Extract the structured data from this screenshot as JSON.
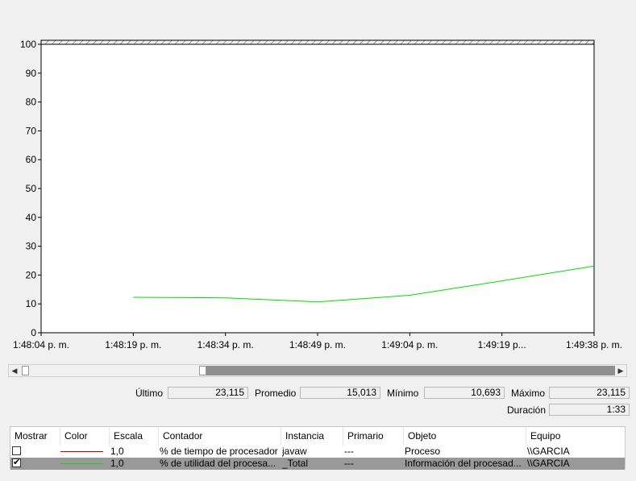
{
  "chart_data": {
    "type": "line",
    "x": [
      "1:48:04 p. m.",
      "1:48:19 p. m.",
      "1:48:34 p. m.",
      "1:48:49 p. m.",
      "1:49:04 p. m.",
      "1:49:19 p...",
      "1:49:38 p. m."
    ],
    "ylim": [
      0,
      100
    ],
    "yticks": [
      0,
      10,
      20,
      30,
      40,
      50,
      60,
      70,
      80,
      90,
      100
    ],
    "grid": false,
    "series": [
      {
        "color": "#00dd00",
        "points": [
          [
            1,
            12.3
          ],
          [
            2,
            12.1
          ],
          [
            3,
            10.7
          ],
          [
            4,
            13.0
          ],
          [
            5,
            18.0
          ],
          [
            6,
            23.1
          ]
        ]
      }
    ]
  },
  "stats": {
    "last_label": "Último",
    "last_value": "23,115",
    "avg_label": "Promedio",
    "avg_value": "15,013",
    "min_label": "Mínimo",
    "min_value": "10,693",
    "max_label": "Máximo",
    "max_value": "23,115",
    "duration_label": "Duración",
    "duration_value": "1:33"
  },
  "legend": {
    "headers": [
      "Mostrar",
      "Color",
      "Escala",
      "Contador",
      "Instancia",
      "Primario",
      "Objeto",
      "Equipo"
    ],
    "rows": [
      {
        "show": false,
        "color": "#cc0000",
        "scale": "1,0",
        "counter": "% de tiempo de procesador",
        "instance": "javaw",
        "parent": "---",
        "object": "Proceso",
        "computer": "\\\\GARCIA",
        "selected": false
      },
      {
        "show": true,
        "check_mark": "✔",
        "color": "#00dd00",
        "scale": "1,0",
        "counter": "% de utilidad del procesa...",
        "instance": "_Total",
        "parent": "---",
        "object": "Información del procesad...",
        "computer": "\\\\GARCIA",
        "selected": true
      }
    ]
  },
  "scrollbar": {
    "left_arrow": "◀",
    "right_arrow": "▶"
  }
}
